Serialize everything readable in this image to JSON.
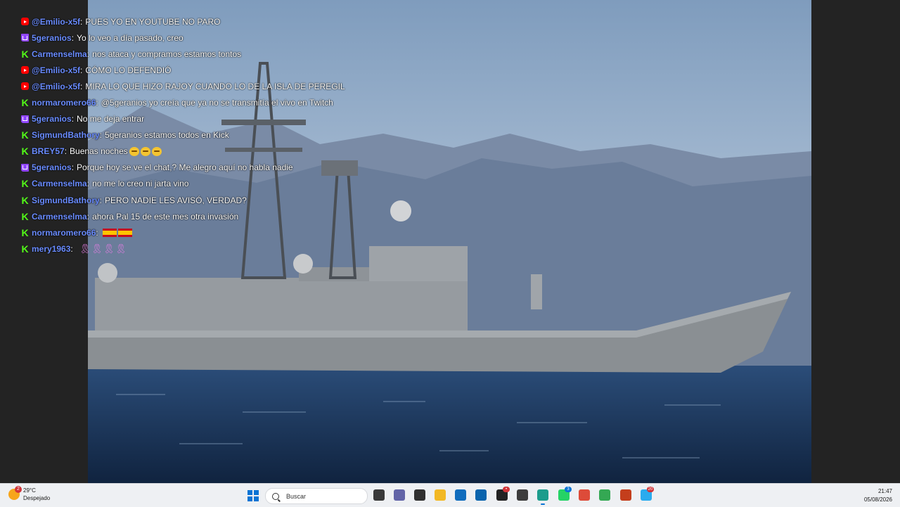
{
  "chat": {
    "messages": [
      {
        "platform": "youtube",
        "user": "@Emilio-x5f",
        "text": "PUES YO EN YOUTUBE NO PARO"
      },
      {
        "platform": "twitch",
        "user": "5geranios",
        "text": "Yo lo veo a día pasado, creo"
      },
      {
        "platform": "kick",
        "user": "Carmenselma",
        "text": "nos ataca y compramos estamos tontos"
      },
      {
        "platform": "youtube",
        "user": "@Emilio-x5f",
        "text": "CÓMO LO DEFENDIÓ"
      },
      {
        "platform": "youtube",
        "user": "@Emilio-x5f",
        "text": "MIRA LO QUE HIZO RAJOY CUANDO LO DE LA ISLA DE PEREGIL"
      },
      {
        "platform": "kick",
        "user": "normaromero66",
        "text": "@5geranios yo creía que ya no se transmitía el vivo en Twitch"
      },
      {
        "platform": "twitch",
        "user": "5geranios",
        "text": "No me deja entrar"
      },
      {
        "platform": "kick",
        "user": "SigmundBathory",
        "text": "5geranios estamos todos en Kick"
      },
      {
        "platform": "kick",
        "user": "BREY57",
        "text": "Buenas noches",
        "emotes": 3
      },
      {
        "platform": "twitch",
        "user": "5geranios",
        "text": "Porque hoy se ve el chat,? Me alegro aquí no habla nadie"
      },
      {
        "platform": "kick",
        "user": "Carmenselma",
        "text": "no me lo creo ni jarta vino"
      },
      {
        "platform": "kick",
        "user": "SigmundBathory",
        "text": "PERO NADIE LES AVISÓ, VERDAD?"
      },
      {
        "platform": "kick",
        "user": "Carmenselma",
        "text": "ahora Pal 15 de este mes otra invasión"
      },
      {
        "platform": "kick",
        "user": "normaromero66",
        "text": "",
        "flags": 2
      },
      {
        "platform": "kick",
        "user": "mery1963",
        "text": "",
        "ribbons": 4
      }
    ]
  },
  "taskbar": {
    "weather_temp": "29°C",
    "weather_desc": "Despejado",
    "weather_badge": "2",
    "search_placeholder": "Buscar",
    "time": "21:47",
    "date": "05/08/2026",
    "apps": [
      {
        "name": "task-view",
        "color": "#3a3a3a"
      },
      {
        "name": "teams",
        "color": "#6264a7"
      },
      {
        "name": "obs",
        "color": "#303030"
      },
      {
        "name": "file-explorer",
        "color": "#f2b824"
      },
      {
        "name": "store",
        "color": "#0f6cbd"
      },
      {
        "name": "outlook",
        "color": "#0a64ad"
      },
      {
        "name": "davinci",
        "color": "#222222",
        "badge": "•"
      },
      {
        "name": "unity",
        "color": "#3c3c3c"
      },
      {
        "name": "edge",
        "color": "#1c9c8c",
        "active": true
      },
      {
        "name": "whatsapp",
        "color": "#25d366",
        "badge": "3"
      },
      {
        "name": "chrome",
        "color": "#dd4b39"
      },
      {
        "name": "chrome-profile",
        "color": "#34a853"
      },
      {
        "name": "powerpoint",
        "color": "#c43e1c"
      },
      {
        "name": "telegram",
        "color": "#2aabee",
        "badge": "20"
      }
    ]
  },
  "colors": {
    "kick": "#53fc18",
    "twitch": "#9146ff",
    "youtube": "#ff0000",
    "username": "#6a8cff"
  }
}
